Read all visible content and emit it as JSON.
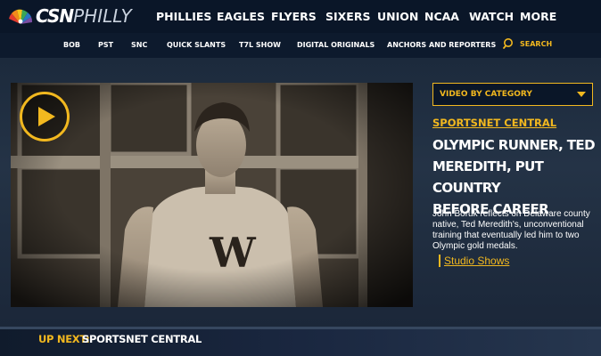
{
  "brand": {
    "logo_primary": "CSN",
    "logo_secondary": "PHILLY",
    "accent_color": "#f2b81f"
  },
  "main_nav": [
    "PHILLIES",
    "EAGLES",
    "FLYERS",
    "SIXERS",
    "UNION",
    "NCAA",
    "WATCH",
    "MORE"
  ],
  "sub_nav": [
    "BOB",
    "PST",
    "SNC",
    "QUICK SLANTS",
    "T7L SHOW",
    "DIGITAL ORIGINALS",
    "ANCHORS AND REPORTERS"
  ],
  "search": {
    "label": "SEARCH",
    "icon": "search-icon"
  },
  "video": {
    "play_icon": "play-icon",
    "jersey_letter": "W"
  },
  "category": {
    "label": "VIDEO BY CATEGORY",
    "icon": "caret-down-icon"
  },
  "article": {
    "section": "SPORTSNET CENTRAL",
    "headline_lines": [
      "OLYMPIC RUNNER, TED",
      "MEREDITH, PUT COUNTRY",
      "BEFORE CAREER"
    ],
    "description_lines": [
      "John Boruk reflects on Delaware county",
      "native, Ted Meredith's, unconventional",
      "training that eventually led him to two",
      "Olympic gold medals."
    ],
    "show_link": "Studio Shows"
  },
  "up_next": {
    "label": "UP NEXT:",
    "title": "SPORTSNET CENTRAL"
  }
}
